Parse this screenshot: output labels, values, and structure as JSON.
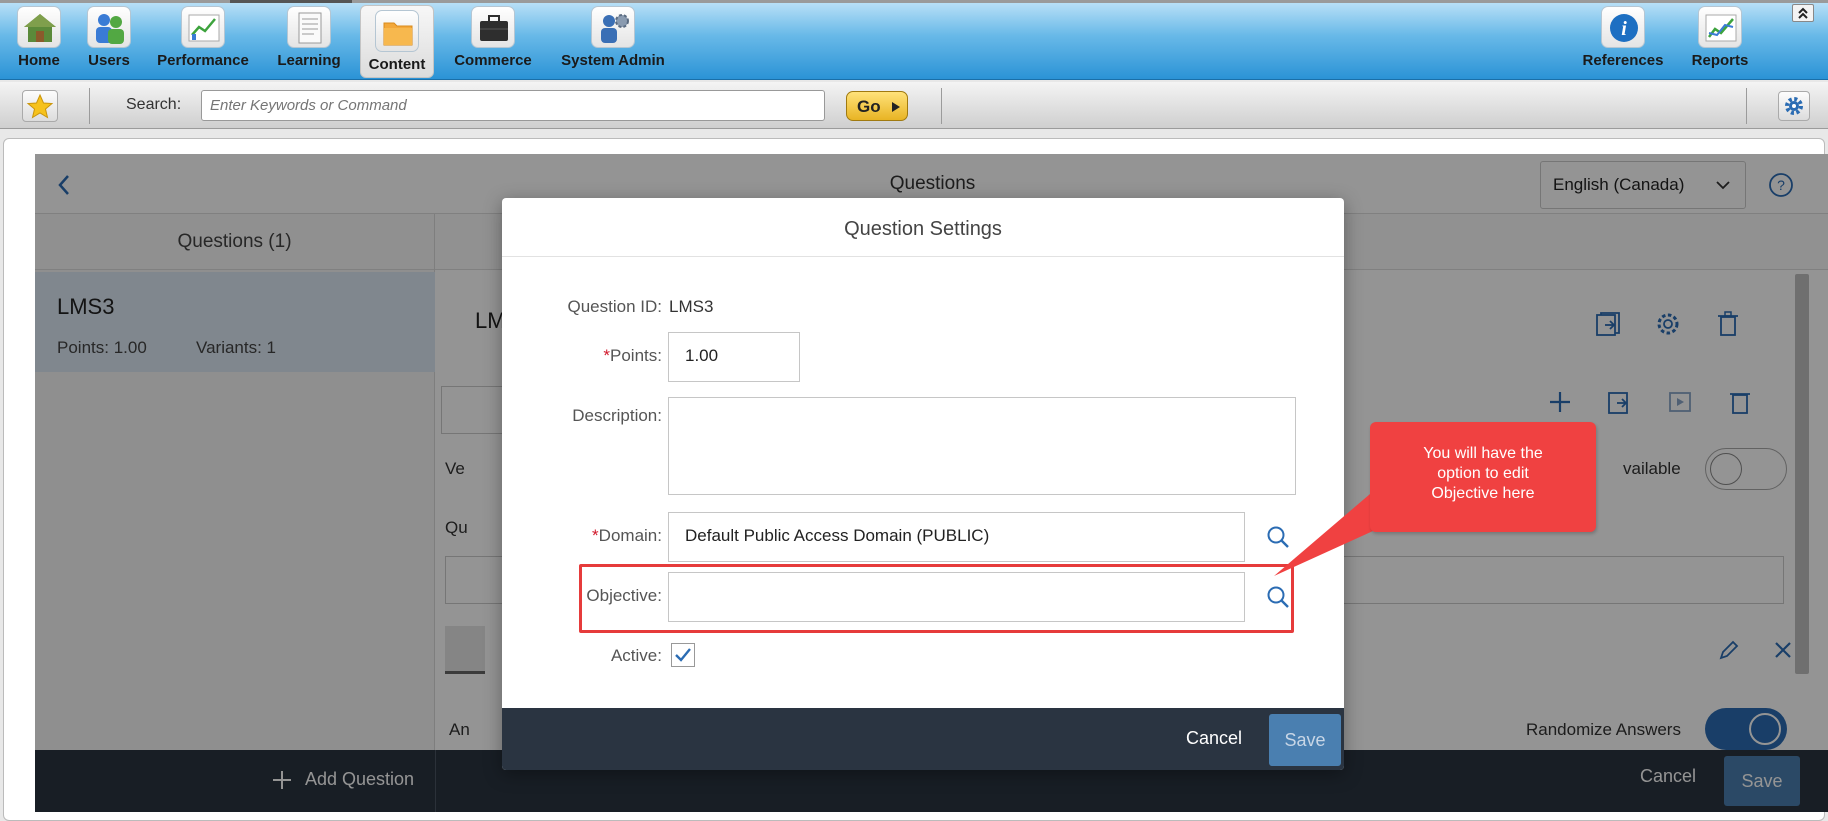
{
  "nav": {
    "items": [
      {
        "label": "Home",
        "icon": "home-icon"
      },
      {
        "label": "Users",
        "icon": "users-icon"
      },
      {
        "label": "Performance",
        "icon": "performance-chart-icon"
      },
      {
        "label": "Learning",
        "icon": "learning-document-icon"
      },
      {
        "label": "Content",
        "icon": "content-folder-icon",
        "active": true
      },
      {
        "label": "Commerce",
        "icon": "briefcase-icon"
      },
      {
        "label": "System Admin",
        "icon": "system-admin-icon"
      },
      {
        "label": "References",
        "icon": "info-icon"
      },
      {
        "label": "Reports",
        "icon": "reports-chart-icon"
      }
    ]
  },
  "toolbar": {
    "search_label": "Search:",
    "search_placeholder": "Enter Keywords or Command",
    "go_label": "Go"
  },
  "page": {
    "title": "Questions",
    "language": "English (Canada)",
    "questions_tab": "Questions (1)",
    "question": {
      "id": "LMS3",
      "points": "Points: 1.00",
      "variants": "Variants: 1"
    },
    "right_title_fragment": "LM",
    "variants_fragment": "Ve",
    "question_label_fragment": "Qu",
    "answers_fragment": "An",
    "available_fragment": "vailable",
    "randomize_label": "Randomize Answers",
    "add_question": "Add Question",
    "footer_cancel": "Cancel",
    "footer_save": "Save"
  },
  "dialog": {
    "title": "Question Settings",
    "question_id_label": "Question ID",
    "question_id_value": "LMS3",
    "points_label": "Points",
    "points_value": "1.00",
    "description_label": "Description",
    "description_value": "",
    "domain_label": "Domain",
    "domain_value": "Default Public Access Domain (PUBLIC)",
    "objective_label": "Objective",
    "objective_value": "",
    "active_label": "Active",
    "active_checked": true,
    "cancel_label": "Cancel",
    "save_label": "Save"
  },
  "callout": {
    "line1": "You will have the",
    "line2": "option to edit",
    "line3": "Objective here"
  },
  "colors": {
    "nav_gradient_top": "#bfe3f8",
    "nav_gradient_bottom": "#2b93d6",
    "dialog_footer": "#2a3441",
    "save_button": "#4a7fb0",
    "callout": "#f04141",
    "highlight_border": "#e63b3b",
    "required_star": "#d1182b"
  }
}
